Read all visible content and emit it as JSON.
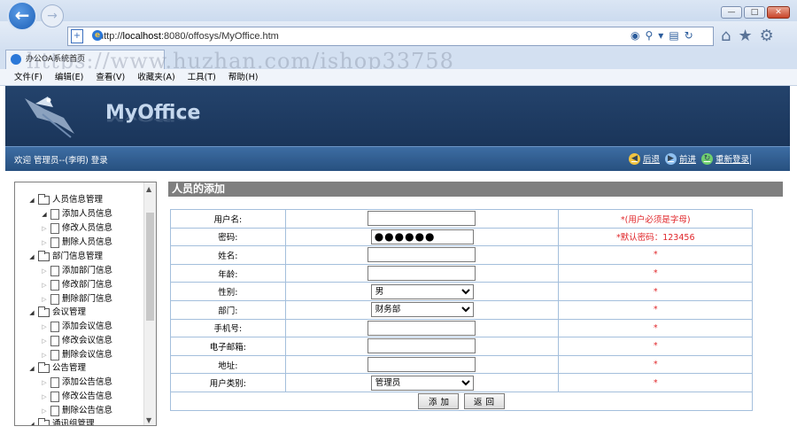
{
  "browser": {
    "address_prefix": "http://",
    "address_host": "localhost",
    "address_rest": ":8080/offosys/MyOffice.htm",
    "tab_title": "办公OA系统首页",
    "window_buttons": [
      "—",
      "□",
      "✕"
    ],
    "watermark": "https://www.huzhan.com/ishop33758",
    "menu": [
      "文件(F)",
      "编辑(E)",
      "查看(V)",
      "收藏夹(A)",
      "工具(T)",
      "帮助(H)"
    ]
  },
  "header": {
    "brand": "MyOffice",
    "welcome": "欢迎 管理员--(李明) 登录",
    "links": [
      {
        "label": "后退",
        "icon": "back-arrow-icon"
      },
      {
        "label": "前进",
        "icon": "forward-arrow-icon"
      },
      {
        "label": "重新登录",
        "icon": "relogin-icon"
      }
    ]
  },
  "sidebar": {
    "groups": [
      {
        "label": "人员信息管理",
        "items": [
          "添加人员信息",
          "修改人员信息",
          "删除人员信息"
        ]
      },
      {
        "label": "部门信息管理",
        "items": [
          "添加部门信息",
          "修改部门信息",
          "删除部门信息"
        ]
      },
      {
        "label": "会议管理",
        "items": [
          "添加会议信息",
          "修改会议信息",
          "删除会议信息"
        ]
      },
      {
        "label": "公告管理",
        "items": [
          "添加公告信息",
          "修改公告信息",
          "删除公告信息"
        ]
      },
      {
        "label": "通讯组管理",
        "items": []
      }
    ]
  },
  "form": {
    "title": "人员的添加",
    "rows": [
      {
        "label": "用户名:",
        "type": "text",
        "value": "",
        "hint": "*(用户必须是字母)"
      },
      {
        "label": "密码:",
        "type": "password",
        "value": "●●●●●●",
        "hint": "*默认密码：123456"
      },
      {
        "label": "姓名:",
        "type": "text",
        "value": "",
        "hint": "*"
      },
      {
        "label": "年龄:",
        "type": "text",
        "value": "",
        "hint": "*"
      },
      {
        "label": "性别:",
        "type": "select",
        "value": "男",
        "hint": "*"
      },
      {
        "label": "部门:",
        "type": "select",
        "value": "财务部",
        "hint": "*"
      },
      {
        "label": "手机号:",
        "type": "text",
        "value": "",
        "hint": "*"
      },
      {
        "label": "电子邮箱:",
        "type": "text",
        "value": "",
        "hint": "*"
      },
      {
        "label": "地址:",
        "type": "text",
        "value": "",
        "hint": "*"
      },
      {
        "label": "用户类别:",
        "type": "select",
        "value": "管理员",
        "hint": "*"
      }
    ],
    "add_button": "添加",
    "back_button": "返回"
  }
}
